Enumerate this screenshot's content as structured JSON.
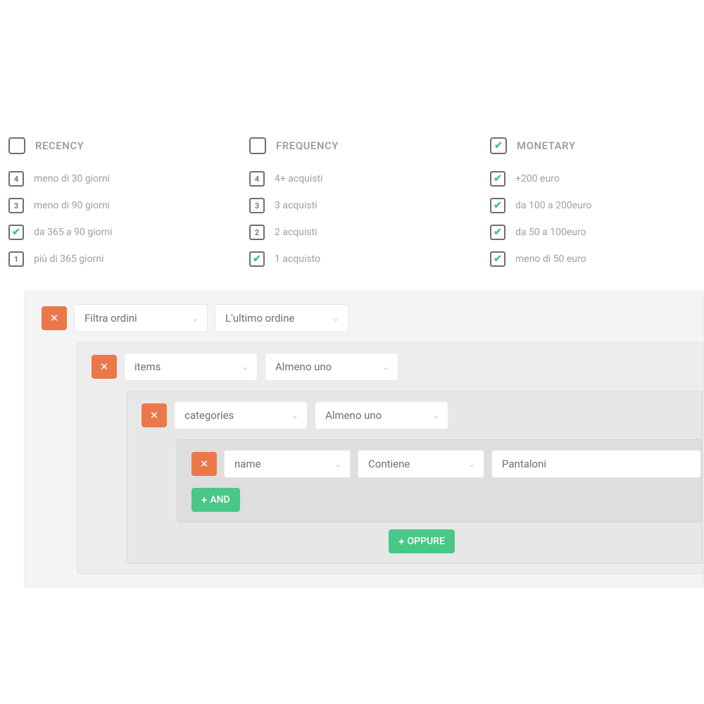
{
  "rfm": {
    "recency": {
      "title": "RECENCY",
      "checked": false,
      "items": [
        {
          "badge": "4",
          "checked": false,
          "label": "meno di 30 giorni"
        },
        {
          "badge": "3",
          "checked": false,
          "label": "meno di 90 giorni"
        },
        {
          "badge": "",
          "checked": true,
          "label": "da 365 a 90 giorni"
        },
        {
          "badge": "1",
          "checked": false,
          "label": "più di 365 giorni"
        }
      ]
    },
    "frequency": {
      "title": "FREQUENCY",
      "checked": false,
      "items": [
        {
          "badge": "4",
          "checked": false,
          "label": "4+ acquisti"
        },
        {
          "badge": "3",
          "checked": false,
          "label": "3 acquisti"
        },
        {
          "badge": "2",
          "checked": false,
          "label": "2 acquisti"
        },
        {
          "badge": "",
          "checked": true,
          "label": "1 acquisto"
        }
      ]
    },
    "monetary": {
      "title": "MONETARY",
      "checked": true,
      "items": [
        {
          "badge": "",
          "checked": true,
          "label": "+200 euro"
        },
        {
          "badge": "",
          "checked": true,
          "label": "da 100 a 200euro"
        },
        {
          "badge": "",
          "checked": true,
          "label": "da 50 a 100euro"
        },
        {
          "badge": "",
          "checked": true,
          "label": "meno di 50 euro"
        }
      ]
    }
  },
  "builder": {
    "level0": {
      "field": "Filtra ordini",
      "scope": "L'ultimo ordine"
    },
    "level1": {
      "field": "items",
      "scope": "Almeno uno"
    },
    "level2": {
      "field": "categories",
      "scope": "Almeno uno"
    },
    "level3": {
      "field": "name",
      "op": "Contiene",
      "value": "Pantaloni"
    },
    "and_label": "AND",
    "or_label": "OPPURE"
  }
}
